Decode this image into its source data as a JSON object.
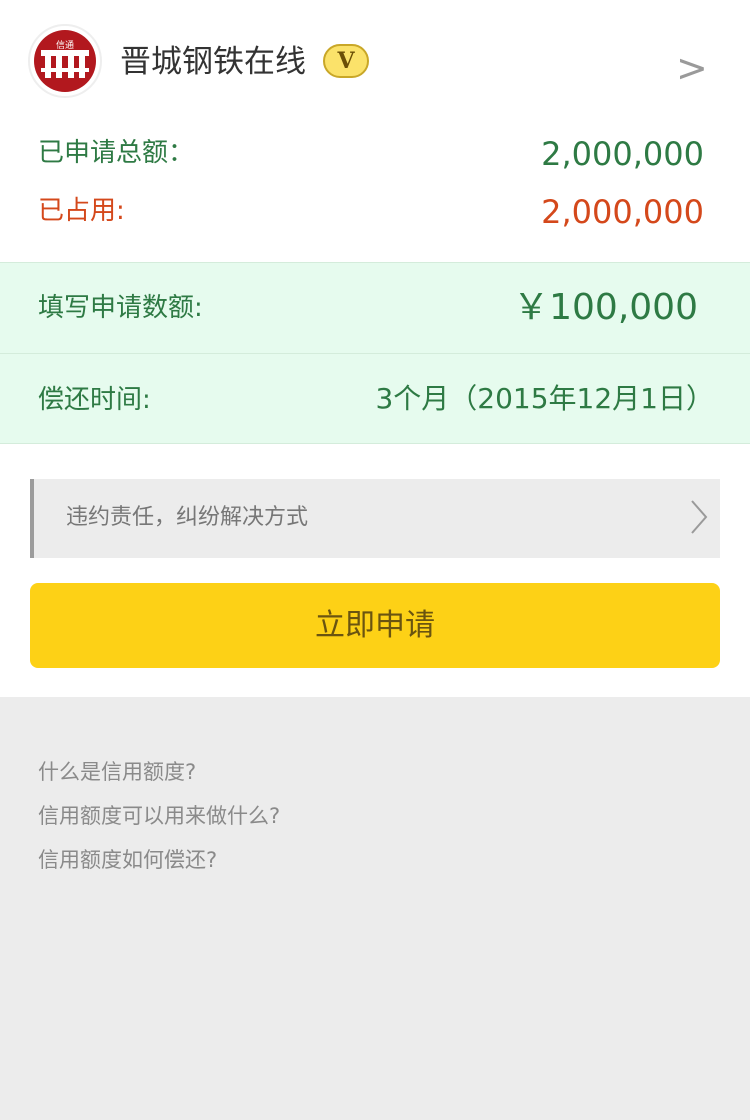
{
  "header": {
    "logo_text": "信通",
    "company_name": "晋城钢铁在线",
    "vip_label": "V",
    "more_glyph": ">"
  },
  "credit": {
    "applied_total_label": "已申请总额：",
    "applied_total_value": "2,000,000",
    "occupied_label": "已占用:",
    "occupied_value": "2,000,000"
  },
  "application": {
    "amount_label": "填写申请数额:",
    "amount_value": "￥100,000",
    "repay_label": "偿还时间:",
    "repay_value": "3个月（2015年12月1日）"
  },
  "terms": {
    "label": "违约责任，纠纷解决方式"
  },
  "apply_button_label": "立即申请",
  "faq": [
    "什么是信用额度?",
    "信用额度可以用来做什么?",
    "信用额度如何偿还?"
  ],
  "colors": {
    "accent_green": "#2e7a44",
    "accent_orange": "#d4481b",
    "button_yellow": "#fdd116",
    "panel_green": "#e6fbee",
    "logo_red": "#b2181e"
  },
  "icons": {
    "more": "chevron-right-icon",
    "terms": "chevron-right-icon",
    "logo": "company-logo"
  }
}
